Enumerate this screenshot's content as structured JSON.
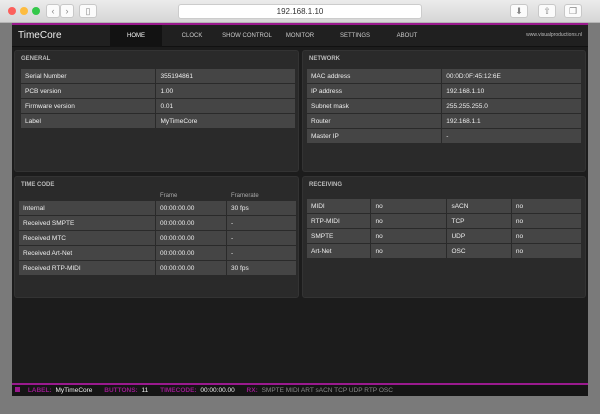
{
  "browser": {
    "url": "192.168.1.10"
  },
  "nav": {
    "brand": "TimeCore",
    "tabs": [
      "HOME",
      "CLOCK",
      "SHOW CONTROL",
      "MONITOR",
      "SETTINGS",
      "ABOUT"
    ],
    "site": "www.visualproductions.nl"
  },
  "general": {
    "title": "GENERAL",
    "rows": [
      [
        "Serial Number",
        "355194861"
      ],
      [
        "PCB version",
        "1.00"
      ],
      [
        "Firmware version",
        "0.01"
      ],
      [
        "Label",
        "MyTimeCore"
      ]
    ]
  },
  "network": {
    "title": "NETWORK",
    "rows": [
      [
        "MAC address",
        "00:0D:0F:45:12:6E"
      ],
      [
        "IP address",
        "192.168.1.10"
      ],
      [
        "Subnet mask",
        "255.255.255.0"
      ],
      [
        "Router",
        "192.168.1.1"
      ],
      [
        "Master IP",
        "-"
      ]
    ]
  },
  "timecode": {
    "title": "TIME CODE",
    "headers": [
      "",
      "Frame",
      "Framerate"
    ],
    "rows": [
      [
        "Internal",
        "00:00:00.00",
        "30 fps"
      ],
      [
        "Received SMPTE",
        "00:00:00.00",
        "-"
      ],
      [
        "Received MTC",
        "00:00:00.00",
        "-"
      ],
      [
        "Received Art-Net",
        "00:00:00.00",
        "-"
      ],
      [
        "Received RTP-MIDI",
        "00:00:00.00",
        "30 fps"
      ]
    ]
  },
  "receiving": {
    "title": "RECEIVING",
    "rows": [
      [
        "MIDI",
        "no",
        "sACN",
        "no"
      ],
      [
        "RTP-MIDI",
        "no",
        "TCP",
        "no"
      ],
      [
        "SMPTE",
        "no",
        "UDP",
        "no"
      ],
      [
        "Art-Net",
        "no",
        "OSC",
        "no"
      ]
    ]
  },
  "status": {
    "label_key": "LABEL:",
    "label": "MyTimeCore",
    "buttons_key": "BUTTONS:",
    "buttons": "11",
    "timecode_key": "TIMECODE:",
    "timecode": "00:00:00.00",
    "rx_key": "RX:",
    "rx": "SMPTE MIDI ART sACN TCP UDP RTP OSC"
  }
}
